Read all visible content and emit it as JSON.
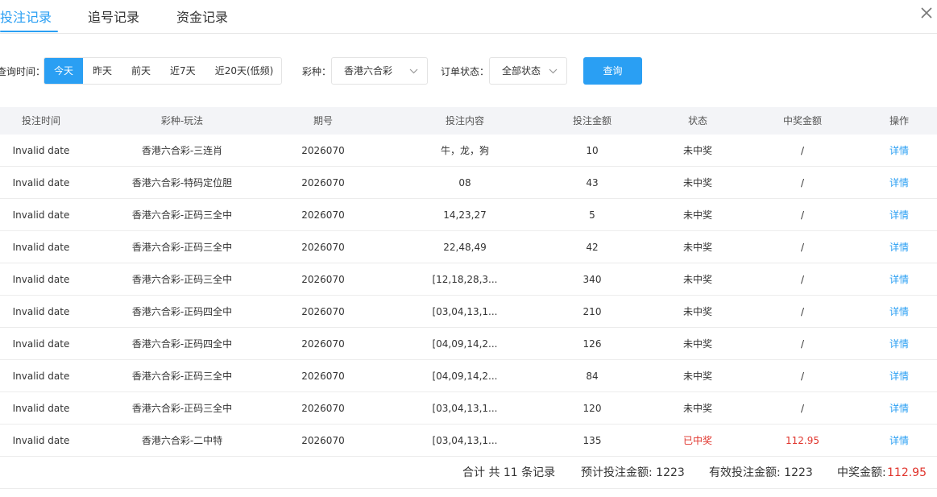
{
  "tabs": [
    {
      "label": "投注记录",
      "active": true
    },
    {
      "label": "追号记录",
      "active": false
    },
    {
      "label": "资金记录",
      "active": false
    }
  ],
  "filters": {
    "time_label": "查询时间：",
    "date_options": [
      "今天",
      "昨天",
      "前天",
      "近7天",
      "近20天(低频)"
    ],
    "lottery_label": "彩种：",
    "lottery_value": "香港六合彩",
    "status_label": "订单状态：",
    "status_value": "全部状态",
    "query_button": "查询"
  },
  "table": {
    "columns": [
      "投注时间",
      "彩种-玩法",
      "期号",
      "投注内容",
      "投注金额",
      "状态",
      "中奖金额",
      "操作"
    ],
    "rows": [
      [
        "Invalid date",
        "香港六合彩-三连肖",
        "2026070",
        "牛，龙，狗",
        "10",
        "未中奖",
        "/",
        "详情"
      ],
      [
        "Invalid date",
        "香港六合彩-特码定位胆",
        "2026070",
        "08",
        "43",
        "未中奖",
        "/",
        "详情"
      ],
      [
        "Invalid date",
        "香港六合彩-正码三全中",
        "2026070",
        "14,23,27",
        "5",
        "未中奖",
        "/",
        "详情"
      ],
      [
        "Invalid date",
        "香港六合彩-正码三全中",
        "2026070",
        "22,48,49",
        "42",
        "未中奖",
        "/",
        "详情"
      ],
      [
        "Invalid date",
        "香港六合彩-正码三全中",
        "2026070",
        "[12,18,28,3...",
        "340",
        "未中奖",
        "/",
        "详情"
      ],
      [
        "Invalid date",
        "香港六合彩-正码四全中",
        "2026070",
        "[03,04,13,1...",
        "210",
        "未中奖",
        "/",
        "详情"
      ],
      [
        "Invalid date",
        "香港六合彩-正码四全中",
        "2026070",
        "[04,09,14,2...",
        "126",
        "未中奖",
        "/",
        "详情"
      ],
      [
        "Invalid date",
        "香港六合彩-正码三全中",
        "2026070",
        "[04,09,14,2...",
        "84",
        "未中奖",
        "/",
        "详情"
      ],
      [
        "Invalid date",
        "香港六合彩-正码三全中",
        "2026070",
        "[03,04,13,1...",
        "120",
        "未中奖",
        "/",
        "详情"
      ],
      [
        "Invalid date",
        "香港六合彩-二中特",
        "2026070",
        "[03,04,13,1...",
        "135",
        "已中奖",
        "112.95",
        "详情"
      ]
    ]
  },
  "summary": {
    "total_text": "合计 共 11 条记录",
    "bet_total_label": "预计投注金额: 1223",
    "valid_total_label": "有效投注金额: 1223",
    "win_label": "中奖金额:",
    "win_value": "112.95"
  },
  "colors": {
    "accent": "#2a9ff3",
    "win": "#e0342c"
  },
  "icons": {
    "close": "close-icon",
    "dropdown": "chevron-down-icon"
  }
}
